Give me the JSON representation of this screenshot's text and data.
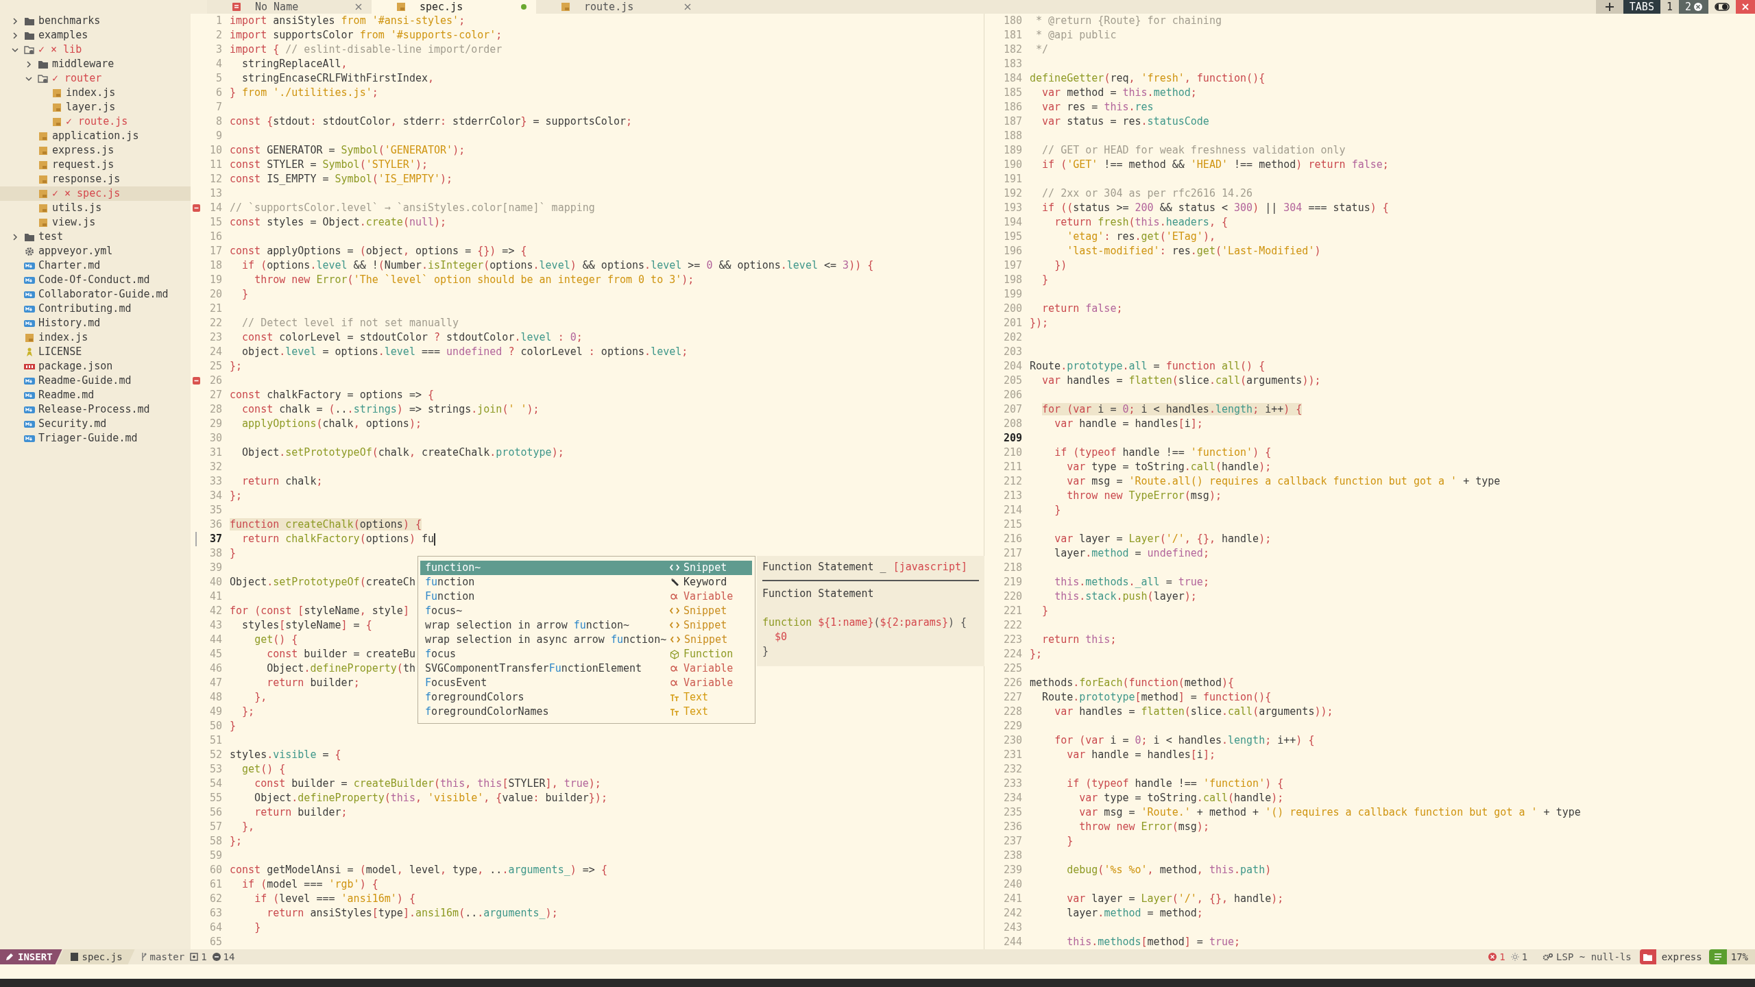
{
  "sidebar": {
    "items": [
      {
        "name": "benchmarks",
        "kind": "folder",
        "expanded": false,
        "selected": false
      },
      {
        "name": "examples",
        "kind": "folder",
        "expanded": false,
        "selected": false
      },
      {
        "name": "lib",
        "kind": "folder",
        "expanded": true,
        "selected": false,
        "git": "✓ ×",
        "children": [
          {
            "name": "middleware",
            "kind": "folder",
            "expanded": false,
            "selected": false
          },
          {
            "name": "router",
            "kind": "folder",
            "expanded": true,
            "selected": false,
            "git": "✓",
            "children": [
              {
                "name": "index.js",
                "kind": "js",
                "selected": false
              },
              {
                "name": "layer.js",
                "kind": "js",
                "selected": false
              },
              {
                "name": "route.js",
                "kind": "js",
                "selected": false,
                "git": "✓"
              }
            ]
          },
          {
            "name": "application.js",
            "kind": "js",
            "selected": false
          },
          {
            "name": "express.js",
            "kind": "js",
            "selected": false
          },
          {
            "name": "request.js",
            "kind": "js",
            "selected": false
          },
          {
            "name": "response.js",
            "kind": "js",
            "selected": false
          },
          {
            "name": "spec.js",
            "kind": "js",
            "selected": true,
            "git": "✓ ×"
          },
          {
            "name": "utils.js",
            "kind": "js",
            "selected": false
          },
          {
            "name": "view.js",
            "kind": "js",
            "selected": false
          }
        ]
      },
      {
        "name": "test",
        "kind": "folder",
        "expanded": false,
        "selected": false
      },
      {
        "name": "appveyor.yml",
        "kind": "config",
        "selected": false
      },
      {
        "name": "Charter.md",
        "kind": "md",
        "selected": false
      },
      {
        "name": "Code-Of-Conduct.md",
        "kind": "md",
        "selected": false
      },
      {
        "name": "Collaborator-Guide.md",
        "kind": "md",
        "selected": false
      },
      {
        "name": "Contributing.md",
        "kind": "md",
        "selected": false
      },
      {
        "name": "History.md",
        "kind": "md",
        "selected": false
      },
      {
        "name": "index.js",
        "kind": "js",
        "selected": false
      },
      {
        "name": "LICENSE",
        "kind": "license",
        "selected": false
      },
      {
        "name": "package.json",
        "kind": "npm",
        "selected": false
      },
      {
        "name": "Readme-Guide.md",
        "kind": "md",
        "selected": false
      },
      {
        "name": "Readme.md",
        "kind": "md",
        "selected": false
      },
      {
        "name": "Release-Process.md",
        "kind": "md",
        "selected": false
      },
      {
        "name": "Security.md",
        "kind": "md",
        "selected": false
      },
      {
        "name": "Triager-Guide.md",
        "kind": "md",
        "selected": false
      }
    ]
  },
  "tabs": [
    {
      "label": "No Name",
      "kind": "untitled",
      "selected": false,
      "modified": false
    },
    {
      "label": "spec.js",
      "kind": "js",
      "selected": true,
      "modified": true
    },
    {
      "label": "route.js",
      "kind": "js",
      "selected": false,
      "modified": false
    }
  ],
  "tab_pages": {
    "label": "TABS",
    "pages": [
      {
        "label": "1",
        "selected": false
      },
      {
        "label": "2",
        "selected": true
      }
    ]
  },
  "panes": [
    {
      "active": true,
      "lines": [
        {
          "n": "1",
          "kind": "plain",
          "code": "import ansiStyles from '#ansi-styles';"
        },
        {
          "n": "2",
          "kind": "plain",
          "code": "import supportsColor from '#supports-color';"
        },
        {
          "n": "3",
          "kind": "plain",
          "code": "import { // eslint-disable-line import/order"
        },
        {
          "n": "4",
          "kind": "plain",
          "code": "  stringReplaceAll,"
        },
        {
          "n": "5",
          "kind": "plain",
          "code": "  stringEncaseCRLFWithFirstIndex,"
        },
        {
          "n": "6",
          "kind": "plain",
          "code": "} from './utilities.js';"
        },
        {
          "n": "7",
          "kind": "plain"
        },
        {
          "n": "8",
          "kind": "plain",
          "code": "const {stdout: stdoutColor, stderr: stderrColor} = supportsColor;"
        },
        {
          "n": "9",
          "kind": "plain"
        },
        {
          "n": "10",
          "kind": "plain",
          "code": "const GENERATOR = Symbol('GENERATOR');"
        },
        {
          "n": "11",
          "kind": "plain",
          "code": "const STYLER = Symbol('STYLER');"
        },
        {
          "n": "12",
          "kind": "plain",
          "code": "const IS_EMPTY = Symbol('IS_EMPTY');"
        },
        {
          "n": "13",
          "kind": "plain"
        },
        {
          "n": "14",
          "kind": "removed",
          "code": "// `supportsColor.level` → `ansiStyles.color[name]` mapping"
        },
        {
          "n": "15",
          "kind": "plain",
          "code": "const styles = Object.create(null);"
        },
        {
          "n": "16",
          "kind": "plain"
        },
        {
          "n": "17",
          "kind": "plain",
          "code": "const applyOptions = (object, options = {}) => {"
        },
        {
          "n": "18",
          "kind": "plain",
          "code": "  if (options.level && !(Number.isInteger(options.level) && options.level >= 0 && options.level <= 3)) {"
        },
        {
          "n": "19",
          "kind": "plain",
          "code": "    throw new Error('The `level` option should be an integer from 0 to 3');"
        },
        {
          "n": "20",
          "kind": "plain",
          "code": "  }"
        },
        {
          "n": "21",
          "kind": "plain"
        },
        {
          "n": "22",
          "kind": "plain",
          "code": "  // Detect level if not set manually"
        },
        {
          "n": "23",
          "kind": "plain",
          "code": "  const colorLevel = stdoutColor ? stdoutColor.level : 0;"
        },
        {
          "n": "24",
          "kind": "plain",
          "code": "  object.level = options.level === undefined ? colorLevel : options.level;"
        },
        {
          "n": "25",
          "kind": "plain",
          "code": "};"
        },
        {
          "n": "26",
          "kind": "removed"
        },
        {
          "n": "27",
          "kind": "plain",
          "code": "const chalkFactory = options => {"
        },
        {
          "n": "28",
          "kind": "plain",
          "code": "  const chalk = (...strings) => strings.join(' ');"
        },
        {
          "n": "29",
          "kind": "plain",
          "code": "  applyOptions(chalk, options);"
        },
        {
          "n": "30",
          "kind": "plain"
        },
        {
          "n": "31",
          "kind": "plain",
          "code": "  Object.setPrototypeOf(chalk, createChalk.prototype);"
        },
        {
          "n": "32",
          "kind": "plain"
        },
        {
          "n": "33",
          "kind": "plain",
          "code": "  return chalk;"
        },
        {
          "n": "34",
          "kind": "plain",
          "code": "};"
        },
        {
          "n": "35",
          "kind": "plain"
        },
        {
          "n": "36",
          "kind": "match",
          "code": "function createChalk(options) {"
        },
        {
          "n": "37",
          "kind": "current",
          "code": "  return chalkFactory(options) fu"
        },
        {
          "n": "38",
          "kind": "plain",
          "code": "}"
        },
        {
          "n": "39",
          "kind": "plain"
        },
        {
          "n": "40",
          "kind": "plain",
          "code": "Object.setPrototypeOf(createCh"
        },
        {
          "n": "41",
          "kind": "plain"
        },
        {
          "n": "42",
          "kind": "plain",
          "code": "for (const [styleName, style]"
        },
        {
          "n": "43",
          "kind": "plain",
          "code": "  styles[styleName] = {"
        },
        {
          "n": "44",
          "kind": "plain",
          "code": "    get() {"
        },
        {
          "n": "45",
          "kind": "plain",
          "code": "      const builder = createBu"
        },
        {
          "n": "46",
          "kind": "plain",
          "code": "      Object.defineProperty(th"
        },
        {
          "n": "47",
          "kind": "plain",
          "code": "      return builder;"
        },
        {
          "n": "48",
          "kind": "plain",
          "code": "    },"
        },
        {
          "n": "49",
          "kind": "plain",
          "code": "  };"
        },
        {
          "n": "50",
          "kind": "plain",
          "code": "}"
        },
        {
          "n": "51",
          "kind": "plain"
        },
        {
          "n": "52",
          "kind": "plain",
          "code": "styles.visible = {"
        },
        {
          "n": "53",
          "kind": "plain",
          "code": "  get() {"
        },
        {
          "n": "54",
          "kind": "plain",
          "code": "    const builder = createBuilder(this, this[STYLER], true);"
        },
        {
          "n": "55",
          "kind": "plain",
          "code": "    Object.defineProperty(this, 'visible', {value: builder});"
        },
        {
          "n": "56",
          "kind": "plain",
          "code": "    return builder;"
        },
        {
          "n": "57",
          "kind": "plain",
          "code": "  },"
        },
        {
          "n": "58",
          "kind": "plain",
          "code": "};"
        },
        {
          "n": "59",
          "kind": "plain"
        },
        {
          "n": "60",
          "kind": "plain",
          "code": "const getModelAnsi = (model, level, type, ...arguments_) => {"
        },
        {
          "n": "61",
          "kind": "plain",
          "code": "  if (model === 'rgb') {"
        },
        {
          "n": "62",
          "kind": "plain",
          "code": "    if (level === 'ansi16m') {"
        },
        {
          "n": "63",
          "kind": "plain",
          "code": "      return ansiStyles[type].ansi16m(...arguments_);"
        },
        {
          "n": "64",
          "kind": "plain",
          "code": "    }"
        },
        {
          "n": "65",
          "kind": "plain"
        }
      ]
    },
    {
      "active": false,
      "lines": [
        {
          "n": "180",
          "kind": "plain",
          "code": " * @return {Route} for chaining"
        },
        {
          "n": "181",
          "kind": "plain",
          "code": " * @api public"
        },
        {
          "n": "182",
          "kind": "plain",
          "code": " */"
        },
        {
          "n": "183",
          "kind": "plain"
        },
        {
          "n": "184",
          "kind": "plain",
          "code": "defineGetter(req, 'fresh', function(){"
        },
        {
          "n": "185",
          "kind": "plain",
          "code": "  var method = this.method;"
        },
        {
          "n": "186",
          "kind": "plain",
          "code": "  var res = this.res"
        },
        {
          "n": "187",
          "kind": "plain",
          "code": "  var status = res.statusCode"
        },
        {
          "n": "188",
          "kind": "plain"
        },
        {
          "n": "189",
          "kind": "plain",
          "code": "  // GET or HEAD for weak freshness validation only"
        },
        {
          "n": "190",
          "kind": "plain",
          "code": "  if ('GET' !== method && 'HEAD' !== method) return false;"
        },
        {
          "n": "191",
          "kind": "plain"
        },
        {
          "n": "192",
          "kind": "plain",
          "code": "  // 2xx or 304 as per rfc2616 14.26"
        },
        {
          "n": "193",
          "kind": "plain",
          "code": "  if ((status >= 200 && status < 300) || 304 === status) {"
        },
        {
          "n": "194",
          "kind": "plain",
          "code": "    return fresh(this.headers, {"
        },
        {
          "n": "195",
          "kind": "plain",
          "code": "      'etag': res.get('ETag'),"
        },
        {
          "n": "196",
          "kind": "plain",
          "code": "      'last-modified': res.get('Last-Modified')"
        },
        {
          "n": "197",
          "kind": "plain",
          "code": "    })"
        },
        {
          "n": "198",
          "kind": "plain",
          "code": "  }"
        },
        {
          "n": "199",
          "kind": "plain"
        },
        {
          "n": "200",
          "kind": "plain",
          "code": "  return false;"
        },
        {
          "n": "201",
          "kind": "plain",
          "code": "});"
        },
        {
          "n": "202",
          "kind": "plain"
        },
        {
          "n": "203",
          "kind": "plain"
        },
        {
          "n": "204",
          "kind": "plain",
          "code": "Route.prototype.all = function all() {"
        },
        {
          "n": "205",
          "kind": "plain",
          "code": "  var handles = flatten(slice.call(arguments));"
        },
        {
          "n": "206",
          "kind": "plain"
        },
        {
          "n": "207",
          "kind": "match",
          "code": "  for (var i = 0; i < handles.length; i++) {"
        },
        {
          "n": "208",
          "kind": "plain",
          "code": "    var handle = handles[i];"
        },
        {
          "n": "209",
          "kind": "current"
        },
        {
          "n": "210",
          "kind": "plain",
          "code": "    if (typeof handle !== 'function') {"
        },
        {
          "n": "211",
          "kind": "plain",
          "code": "      var type = toString.call(handle);"
        },
        {
          "n": "212",
          "kind": "plain",
          "code": "      var msg = 'Route.all() requires a callback function but got a ' + type"
        },
        {
          "n": "213",
          "kind": "plain",
          "code": "      throw new TypeError(msg);"
        },
        {
          "n": "214",
          "kind": "plain",
          "code": "    }"
        },
        {
          "n": "215",
          "kind": "plain"
        },
        {
          "n": "216",
          "kind": "plain",
          "code": "    var layer = Layer('/', {}, handle);"
        },
        {
          "n": "217",
          "kind": "plain",
          "code": "    layer.method = undefined;"
        },
        {
          "n": "218",
          "kind": "plain"
        },
        {
          "n": "219",
          "kind": "plain",
          "code": "    this.methods._all = true;"
        },
        {
          "n": "220",
          "kind": "plain",
          "code": "    this.stack.push(layer);"
        },
        {
          "n": "221",
          "kind": "plain",
          "code": "  }"
        },
        {
          "n": "222",
          "kind": "plain"
        },
        {
          "n": "223",
          "kind": "plain",
          "code": "  return this;"
        },
        {
          "n": "224",
          "kind": "plain",
          "code": "};"
        },
        {
          "n": "225",
          "kind": "plain"
        },
        {
          "n": "226",
          "kind": "plain",
          "code": "methods.forEach(function(method){"
        },
        {
          "n": "227",
          "kind": "plain",
          "code": "  Route.prototype[method] = function(){"
        },
        {
          "n": "228",
          "kind": "plain",
          "code": "    var handles = flatten(slice.call(arguments));"
        },
        {
          "n": "229",
          "kind": "plain"
        },
        {
          "n": "230",
          "kind": "plain",
          "code": "    for (var i = 0; i < handles.length; i++) {"
        },
        {
          "n": "231",
          "kind": "plain",
          "code": "      var handle = handles[i];"
        },
        {
          "n": "232",
          "kind": "plain"
        },
        {
          "n": "233",
          "kind": "plain",
          "code": "      if (typeof handle !== 'function') {"
        },
        {
          "n": "234",
          "kind": "plain",
          "code": "        var type = toString.call(handle);"
        },
        {
          "n": "235",
          "kind": "plain",
          "code": "        var msg = 'Route.' + method + '() requires a callback function but got a ' + type"
        },
        {
          "n": "236",
          "kind": "plain",
          "code": "        throw new Error(msg);"
        },
        {
          "n": "237",
          "kind": "plain",
          "code": "      }"
        },
        {
          "n": "238",
          "kind": "plain"
        },
        {
          "n": "239",
          "kind": "plain",
          "code": "      debug('%s %o', method, this.path)"
        },
        {
          "n": "240",
          "kind": "plain"
        },
        {
          "n": "241",
          "kind": "plain",
          "code": "      var layer = Layer('/', {}, handle);"
        },
        {
          "n": "242",
          "kind": "plain",
          "code": "      layer.method = method;"
        },
        {
          "n": "243",
          "kind": "plain"
        },
        {
          "n": "244",
          "kind": "plain",
          "code": "      this.methods[method] = true;"
        }
      ]
    }
  ],
  "completion": {
    "items": [
      {
        "match": "fu",
        "after": "nction~",
        "kind": "snippet",
        "type": "Snippet",
        "selected": true
      },
      {
        "match": "fu",
        "after": "nction",
        "kind": "keyword",
        "type": "Keyword",
        "selected": false
      },
      {
        "match": "Fu",
        "after": "nction",
        "kind": "variable",
        "type": "Variable",
        "selected": false
      },
      {
        "match": "f",
        "after": "ocus~",
        "kind": "snippet",
        "type": "Snippet",
        "selected": false
      },
      {
        "before": "wrap selection in arrow ",
        "match": "fu",
        "after": "nction~",
        "kind": "snippet",
        "type": "Snippet",
        "selected": false
      },
      {
        "before": "wrap selection in async arrow ",
        "match": "fu",
        "after": "nction~",
        "kind": "snippet",
        "type": "Snippet",
        "selected": false
      },
      {
        "match": "f",
        "after": "ocus",
        "kind": "function",
        "type": "Function",
        "selected": false
      },
      {
        "before": "SVGComponentTransfer",
        "match": "Fu",
        "after": "nctionElement",
        "kind": "variable",
        "type": "Variable",
        "selected": false
      },
      {
        "match": "F",
        "after": "ocusEvent",
        "kind": "variable",
        "type": "Variable",
        "selected": false
      },
      {
        "match": "f",
        "after": "oregroundColors",
        "kind": "text",
        "type": "Text",
        "selected": false
      },
      {
        "match": "f",
        "after": "oregroundColorNames",
        "kind": "text",
        "type": "Text",
        "selected": false
      }
    ],
    "doc": {
      "title": "Function Statement _",
      "language": "[javascript]",
      "heading": "Function Statement",
      "snippet": [
        "function ${1:name}(${2:params}) {",
        "  $0",
        "}"
      ]
    }
  },
  "status_bar": {
    "mode": "INSERT",
    "file": "spec.js",
    "branch": "master",
    "staged": "1",
    "removed": "14",
    "errors": "1",
    "warnings": "1",
    "lsp": "LSP ~ null-ls",
    "project": "express",
    "progress": "17%"
  }
}
